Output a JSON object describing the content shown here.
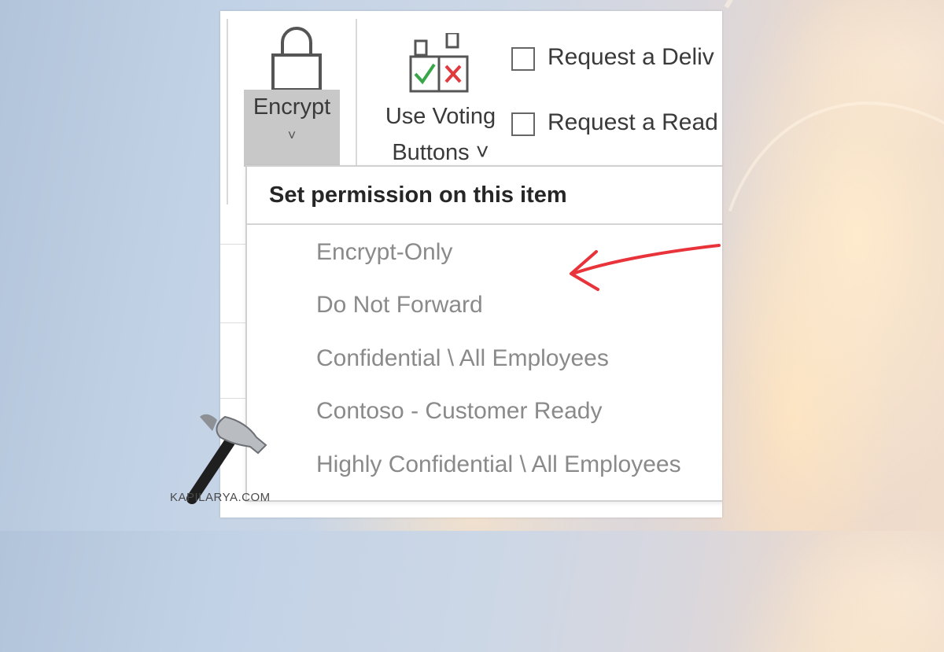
{
  "ribbon": {
    "encrypt": {
      "label": "Encrypt",
      "chevron": "˅",
      "icon": "lock-icon"
    },
    "voting": {
      "label_line1": "Use Voting",
      "label_line2": "Buttons ˅",
      "icon": "voting-buttons-icon"
    },
    "options": [
      {
        "label": "Request a Deliv",
        "checked": false
      },
      {
        "label": "Request a Read",
        "checked": false
      }
    ]
  },
  "encrypt_menu": {
    "header": "Set permission on this item",
    "items": [
      {
        "label": "Encrypt-Only"
      },
      {
        "label": "Do Not Forward"
      },
      {
        "label": "Confidential \\ All Employees"
      },
      {
        "label": "Contoso - Customer Ready"
      },
      {
        "label": "Highly Confidential \\ All Employees"
      }
    ]
  },
  "annotation": {
    "arrow_color": "#e8333a",
    "points_to": "Encrypt-Only"
  },
  "watermark": {
    "text": "KAPILARYA.COM",
    "icon": "hammer-icon"
  },
  "colors": {
    "check": "#3aa64a",
    "cross": "#e0393e",
    "encrypt_button_bg": "#c8c8c8"
  }
}
